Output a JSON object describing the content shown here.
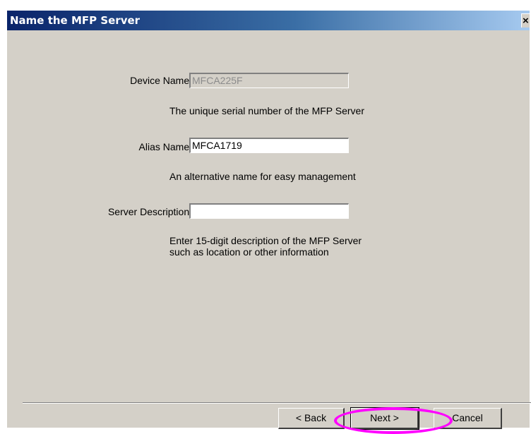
{
  "window": {
    "title": "Name the MFP Server"
  },
  "title_bar": {
    "close_glyph": "×"
  },
  "icons": {
    "close": "close-icon"
  },
  "form": {
    "device_name": {
      "label": "Device Name:",
      "value": "MFCA225F",
      "description": "The unique serial number of the MFP Server"
    },
    "alias_name": {
      "label": "Alias Name:",
      "value": "MFCA1719",
      "description": "An alternative name for easy management"
    },
    "server_description": {
      "label": "Server Description:",
      "value": "",
      "description_line1": "Enter 15-digit description of the MFP Server",
      "description_line2": "such as location or other information"
    }
  },
  "buttons": {
    "back": "< Back",
    "next": "Next >",
    "cancel": "Cancel"
  },
  "colors": {
    "window_bg": "#d4d0c8",
    "title_bar": "#0a246a",
    "highlight_ring": "#ff00ff"
  }
}
